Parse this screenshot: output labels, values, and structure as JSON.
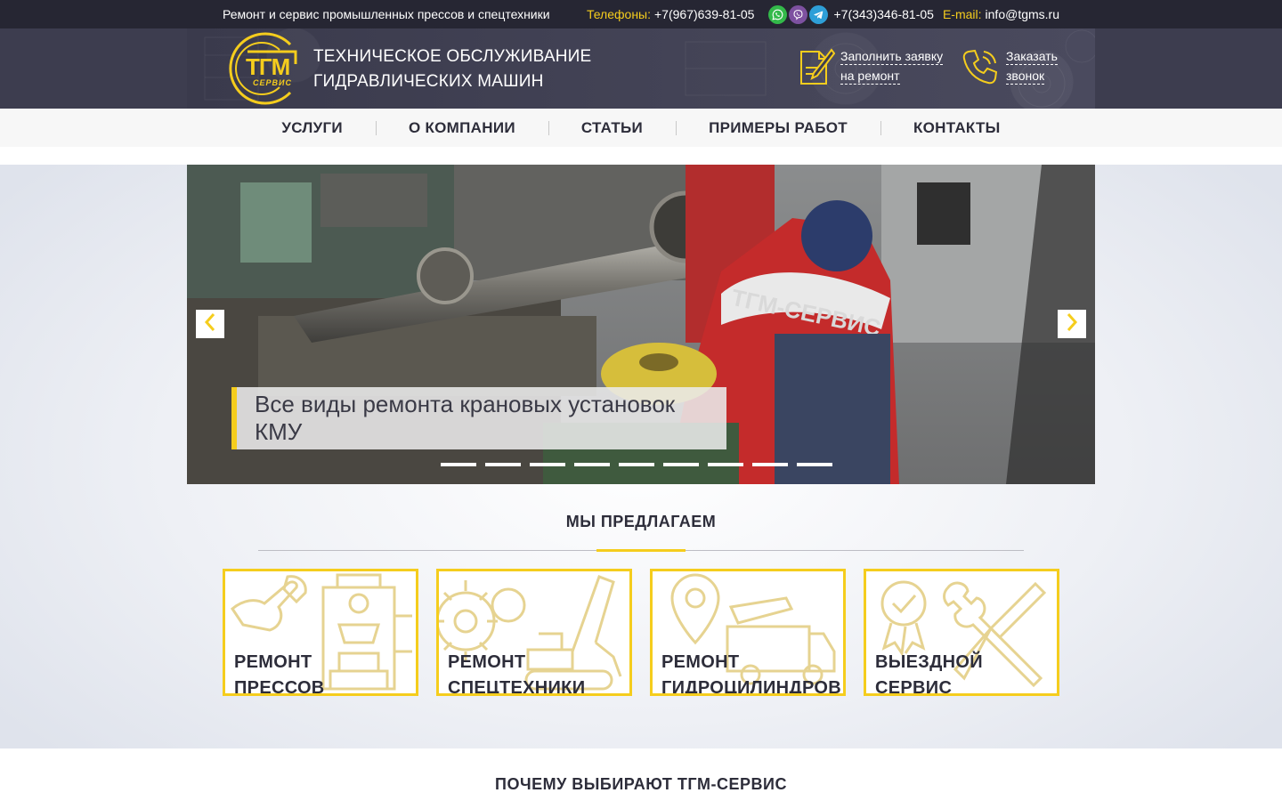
{
  "topbar": {
    "tagline": "Ремонт и сервис промышленных прессов и спецтехники",
    "phones_label": "Телефоны:",
    "phone1": "+7(967)639-81-05",
    "phone2": "+7(343)346-81-05",
    "email_label": "E-mail:",
    "email": "info@tgms.ru",
    "messengers": [
      "whatsapp-icon",
      "viber-icon",
      "telegram-icon"
    ]
  },
  "header": {
    "logo_text": "ТГМ",
    "logo_subtext": "СЕРВИС",
    "slogan_line1": "ТЕХНИЧЕСКОЕ ОБСЛУЖИВАНИЕ",
    "slogan_line2": "ГИДРАВЛИЧЕСКИХ МАШИН",
    "request_line1": "Заполнить заявку",
    "request_line2": "на ремонт",
    "call_line1": "Заказать",
    "call_line2": "звонок"
  },
  "nav": {
    "items": [
      "УСЛУГИ",
      "О КОМПАНИИ",
      "СТАТЬИ",
      "ПРИМЕРЫ РАБОТ",
      "КОНТАКТЫ"
    ]
  },
  "slider": {
    "caption": "Все виды ремонта крановых установок КМУ",
    "jacket_text": "ТГМ-СЕРВИС",
    "slide_count": 9
  },
  "offers": {
    "title": "МЫ ПРЕДЛАГАЕМ",
    "cards": [
      {
        "line1": "РЕМОНТ",
        "line2": "ПРЕССОВ",
        "icon": "press-repair-icon"
      },
      {
        "line1": "РЕМОНТ",
        "line2": "СПЕЦТЕХНИКИ",
        "icon": "excavator-icon"
      },
      {
        "line1": "РЕМОНТ",
        "line2": "ГИДРОЦИЛИНДРОВ",
        "icon": "crane-truck-icon"
      },
      {
        "line1": "ВЫЕЗДНОЙ",
        "line2": "СЕРВИС",
        "icon": "tools-icon"
      }
    ]
  },
  "why": {
    "title": "ПОЧЕМУ ВЫБИРАЮТ ТГМ-СЕРВИС"
  },
  "colors": {
    "accent": "#f5cd1d",
    "dark": "#262633",
    "header_bg": "#3d3d4f"
  }
}
